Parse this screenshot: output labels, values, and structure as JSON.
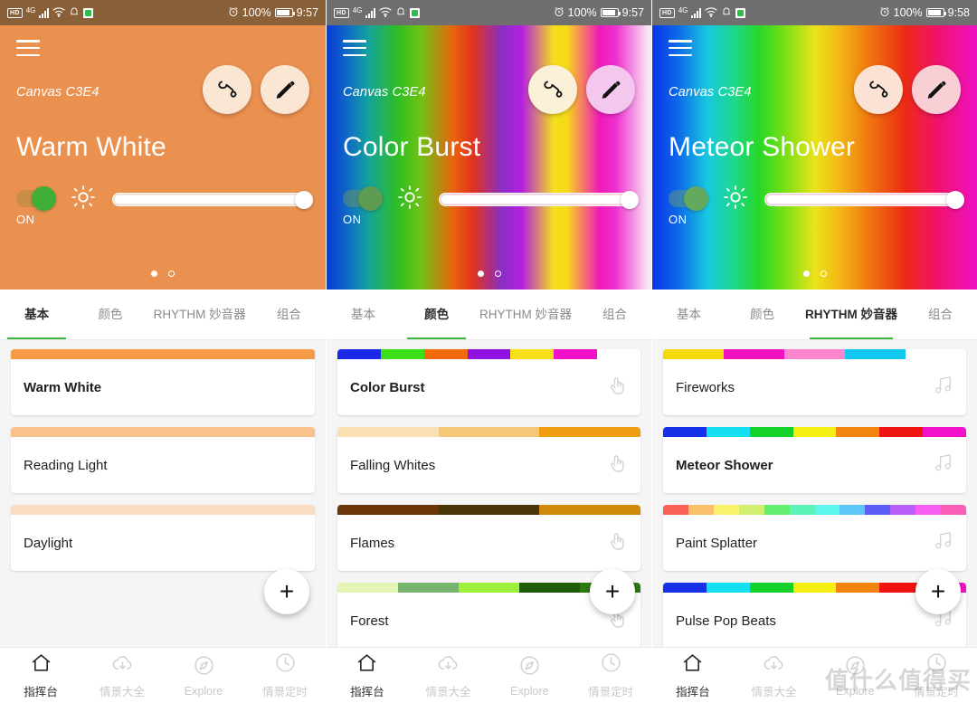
{
  "panels": [
    {
      "status": {
        "time": "9:57",
        "battery": "100%",
        "network": "4G",
        "hd": "HD"
      },
      "hero": {
        "device": "Canvas C3E4",
        "scene": "Warm White",
        "toggle_label": "ON",
        "brightness_pct": 100,
        "paint_icon": "paint-bucket-icon",
        "pencil_icon": "pencil-icon",
        "menu_icon": "hamburger-icon",
        "brightness_icon": "sun-icon"
      },
      "tabs": [
        {
          "label": "基本",
          "active": true
        },
        {
          "label": "颜色",
          "active": false
        },
        {
          "label": "RHYTHM 妙音器",
          "active": false,
          "wide": true
        },
        {
          "label": "组合",
          "active": false
        }
      ],
      "items": [
        {
          "title": "Warm White",
          "bold": true,
          "icon": "none",
          "colors": [
            "#f79a48"
          ]
        },
        {
          "title": "Reading Light",
          "bold": false,
          "icon": "none",
          "colors": [
            "#f9c18c"
          ]
        },
        {
          "title": "Daylight",
          "bold": false,
          "icon": "none",
          "colors": [
            "#fadcc2"
          ]
        }
      ],
      "fab_label": "+",
      "nav": [
        {
          "label": "指挥台",
          "icon": "home-icon",
          "active": true
        },
        {
          "label": "情景大全",
          "icon": "cloud-download-icon",
          "active": false
        },
        {
          "label": "Explore",
          "icon": "compass-icon",
          "active": false
        },
        {
          "label": "情景定时",
          "icon": "clock-icon",
          "active": false
        }
      ]
    },
    {
      "status": {
        "time": "9:57",
        "battery": "100%",
        "network": "4G",
        "hd": "HD"
      },
      "hero": {
        "device": "Canvas C3E4",
        "scene": "Color Burst",
        "toggle_label": "ON",
        "brightness_pct": 100,
        "paint_icon": "paint-bucket-icon",
        "pencil_icon": "pencil-icon",
        "menu_icon": "hamburger-icon",
        "brightness_icon": "sun-icon"
      },
      "tabs": [
        {
          "label": "基本",
          "active": false
        },
        {
          "label": "颜色",
          "active": true
        },
        {
          "label": "RHYTHM 妙音器",
          "active": false,
          "wide": true
        },
        {
          "label": "组合",
          "active": false
        }
      ],
      "items": [
        {
          "title": "Color Burst",
          "bold": true,
          "icon": "touch-icon",
          "colors": [
            "#1a28e8",
            "#3ce016",
            "#f26a0c",
            "#8f12e0",
            "#f7e017",
            "#f211c8",
            "#ffffff"
          ]
        },
        {
          "title": "Falling Whites",
          "bold": false,
          "icon": "touch-icon",
          "colors": [
            "#fbe0b4",
            "#f5c877",
            "#ef9d11"
          ]
        },
        {
          "title": "Flames",
          "bold": false,
          "icon": "touch-icon",
          "colors": [
            "#6b3608",
            "#4a3508",
            "#cf8a09"
          ]
        },
        {
          "title": "Forest",
          "bold": false,
          "icon": "touch-icon",
          "colors": [
            "#e4f5b3",
            "#77b56e",
            "#9ef03b",
            "#1f5c09",
            "#2b7a12"
          ]
        }
      ],
      "fab_label": "+",
      "nav": [
        {
          "label": "指挥台",
          "icon": "home-icon",
          "active": true
        },
        {
          "label": "情景大全",
          "icon": "cloud-download-icon",
          "active": false
        },
        {
          "label": "Explore",
          "icon": "compass-icon",
          "active": false
        },
        {
          "label": "情景定时",
          "icon": "clock-icon",
          "active": false
        }
      ]
    },
    {
      "status": {
        "time": "9:58",
        "battery": "100%",
        "network": "4G",
        "hd": "HD"
      },
      "hero": {
        "device": "Canvas C3E4",
        "scene": "Meteor Shower",
        "toggle_label": "ON",
        "brightness_pct": 100,
        "paint_icon": "paint-bucket-icon",
        "pencil_icon": "pencil-icon",
        "menu_icon": "hamburger-icon",
        "brightness_icon": "sun-icon"
      },
      "tabs": [
        {
          "label": "基本",
          "active": false
        },
        {
          "label": "颜色",
          "active": false
        },
        {
          "label": "RHYTHM 妙音器",
          "active": true,
          "wide": true
        },
        {
          "label": "组合",
          "active": false
        }
      ],
      "items": [
        {
          "title": "Fireworks",
          "bold": false,
          "icon": "music-note-icon",
          "colors": [
            "#f7d80c",
            "#f211c0",
            "#fa85ce",
            "#13c8f0",
            "#ffffff"
          ]
        },
        {
          "title": "Meteor Shower",
          "bold": true,
          "icon": "music-note-icon",
          "colors": [
            "#1630e8",
            "#14e0f2",
            "#14d22a",
            "#f5ee12",
            "#f2860c",
            "#ef1410",
            "#f211c8"
          ]
        },
        {
          "title": "Paint Splatter",
          "bold": false,
          "icon": "music-note-icon",
          "colors": [
            "#fa6258",
            "#fbc06a",
            "#fbf36e",
            "#cff06e",
            "#63f06e",
            "#5cf2b8",
            "#5ef5ef",
            "#5cc6f7",
            "#5d5ef7",
            "#b95ef7",
            "#f95ef2",
            "#fa5eb8"
          ]
        },
        {
          "title": "Pulse Pop Beats",
          "bold": false,
          "icon": "music-note-icon",
          "colors": [
            "#1630e8",
            "#14e0f2",
            "#14d22a",
            "#f5ee12",
            "#f2860c",
            "#ef1410",
            "#f211c8"
          ]
        }
      ],
      "fab_label": "+",
      "nav": [
        {
          "label": "指挥台",
          "icon": "home-icon",
          "active": true
        },
        {
          "label": "情景大全",
          "icon": "cloud-download-icon",
          "active": false
        },
        {
          "label": "Explore",
          "icon": "compass-icon",
          "active": false
        },
        {
          "label": "情景定时",
          "icon": "clock-icon",
          "active": false
        }
      ]
    }
  ],
  "watermark": "值什么值得买"
}
